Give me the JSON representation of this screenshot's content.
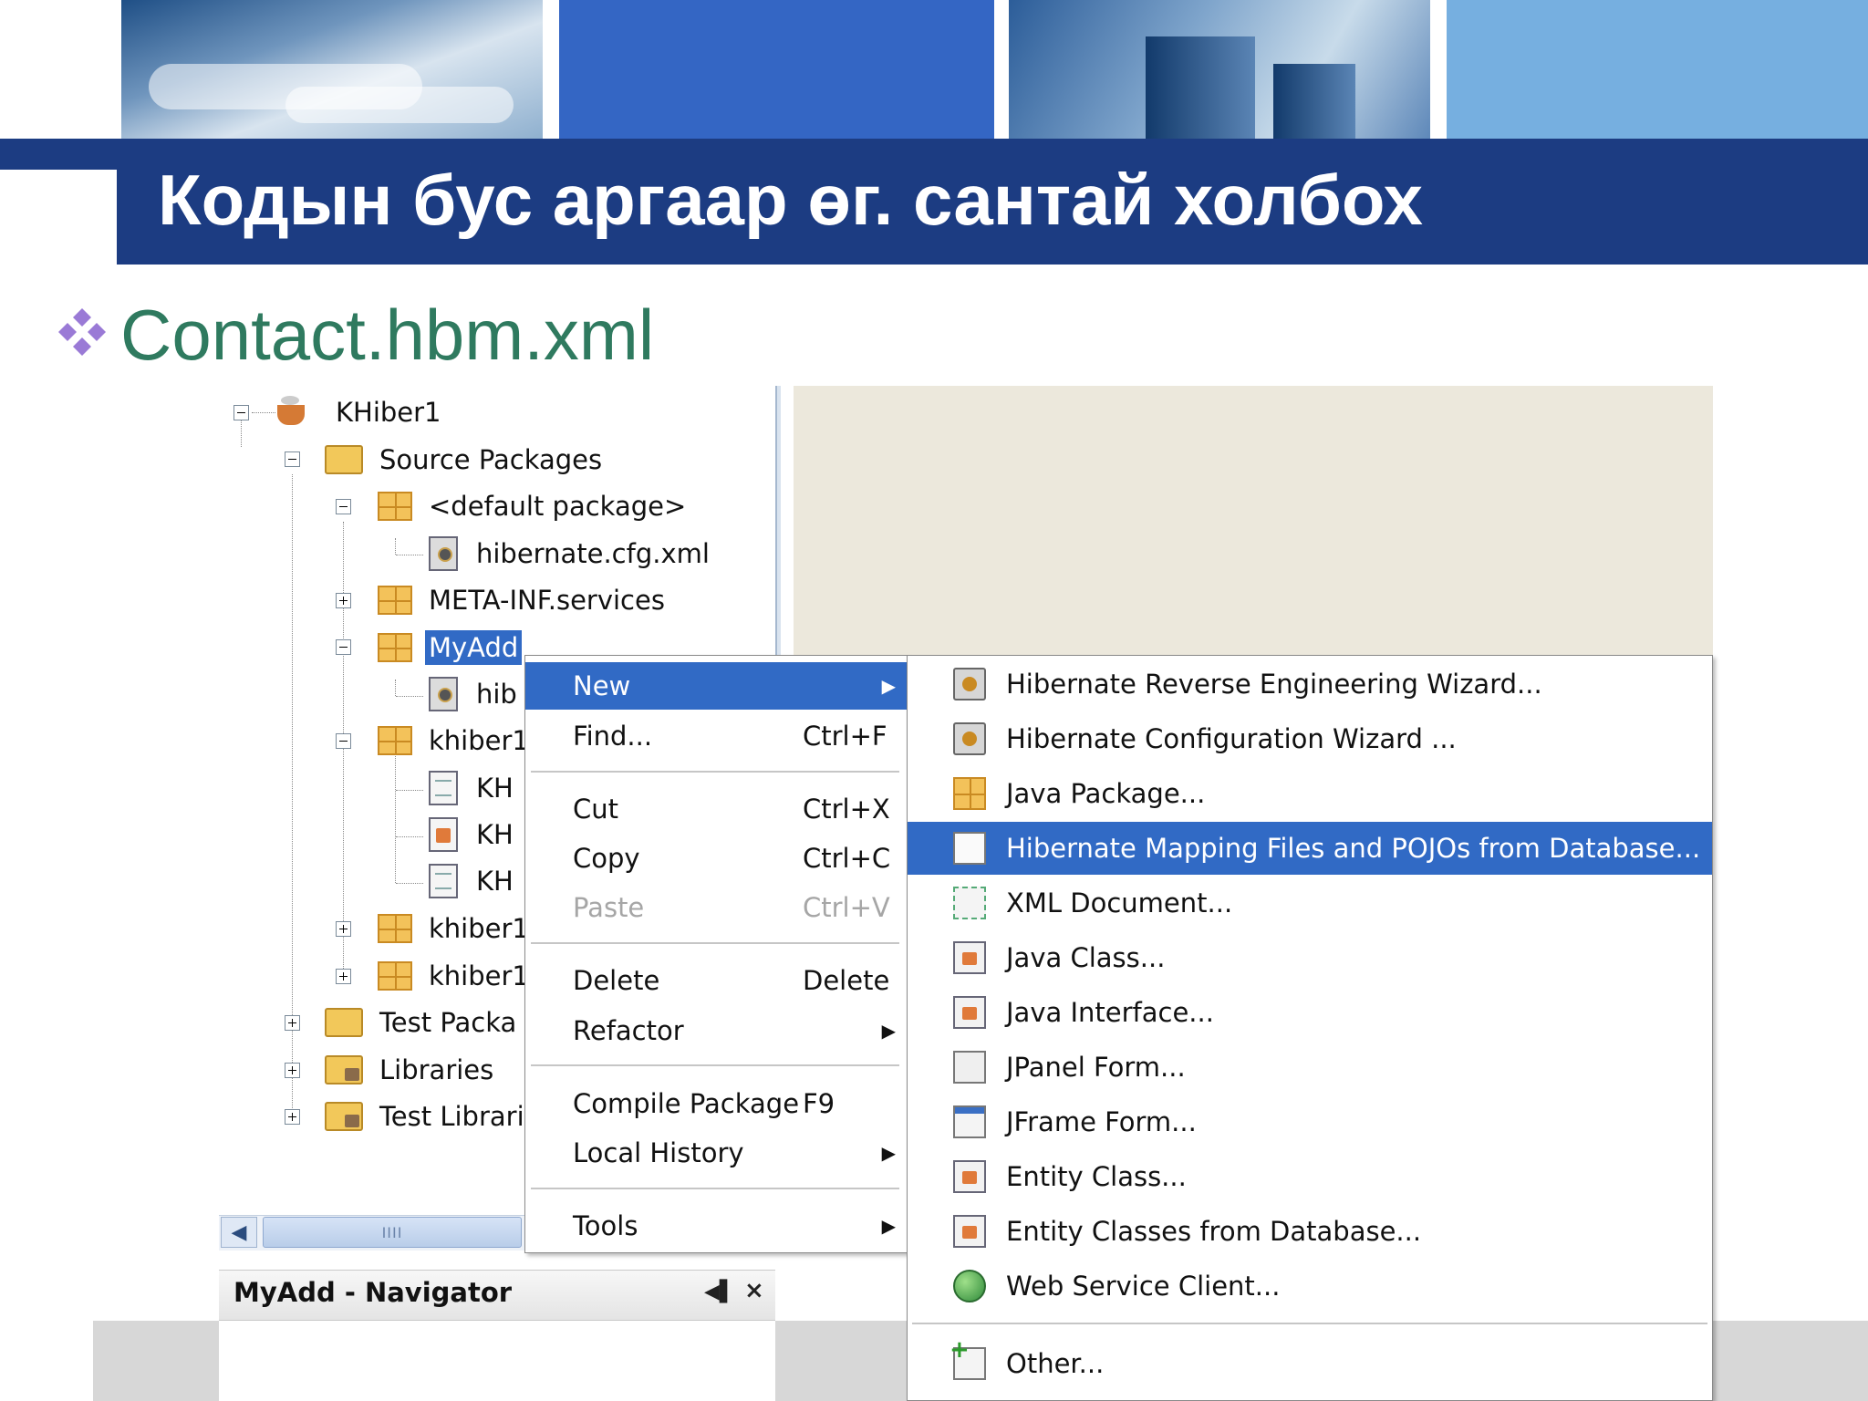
{
  "slide": {
    "title": "Кодын бус аргаар өг. сантай холбох",
    "bullet": "Contact.hbm.xml"
  },
  "tree": {
    "project": "KHiber1",
    "source_packages": "Source Packages",
    "default_package": "<default package>",
    "hibernate_cfg": "hibernate.cfg.xml",
    "meta_inf": "META-INF.services",
    "myadd": "MyAdd",
    "myadd_child": "hib",
    "khiber_pkg_1": "khiber1",
    "kh_file_1": "KH",
    "kh_file_2": "KH",
    "kh_file_3": "KH",
    "khiber_pkg_2": "khiber1",
    "khiber_pkg_3": "khiber1",
    "test_packages": "Test Packa",
    "libraries": "Libraries",
    "test_libraries": "Test Librari"
  },
  "scrollbar": {
    "grip": "IIII"
  },
  "navigator": {
    "title": "MyAdd - Navigator",
    "dock_glyph": "◀▌",
    "close_glyph": "×"
  },
  "context_menu": {
    "new": "New",
    "find": "Find...",
    "find_shortcut": "Ctrl+F",
    "cut": "Cut",
    "cut_shortcut": "Ctrl+X",
    "copy": "Copy",
    "copy_shortcut": "Ctrl+C",
    "paste": "Paste",
    "paste_shortcut": "Ctrl+V",
    "delete": "Delete",
    "delete_shortcut": "Delete",
    "refactor": "Refactor",
    "compile": "Compile Package",
    "compile_shortcut": "F9",
    "local_history": "Local History",
    "tools": "Tools"
  },
  "submenu": {
    "items": [
      {
        "label": "Hibernate Reverse Engineering Wizard...",
        "icon": "hibernate-reveng-icon"
      },
      {
        "label": "Hibernate Configuration Wizard ...",
        "icon": "hibernate-config-icon"
      },
      {
        "label": "Java Package...",
        "icon": "java-package-icon"
      },
      {
        "label": "Hibernate Mapping Files and POJOs from Database...",
        "icon": "blank-file-icon"
      },
      {
        "label": "XML Document...",
        "icon": "xml-document-icon"
      },
      {
        "label": "Java Class...",
        "icon": "java-class-icon"
      },
      {
        "label": "Java Interface...",
        "icon": "java-interface-icon"
      },
      {
        "label": "JPanel Form...",
        "icon": "jpanel-form-icon"
      },
      {
        "label": "JFrame Form...",
        "icon": "jframe-form-icon"
      },
      {
        "label": "Entity Class...",
        "icon": "entity-class-icon"
      },
      {
        "label": "Entity Classes from Database...",
        "icon": "entity-classes-db-icon"
      },
      {
        "label": "Web Service Client...",
        "icon": "web-service-globe-icon"
      },
      {
        "label": "Other...",
        "icon": "other-file-icon"
      }
    ]
  },
  "colors": {
    "title_band": "#1c3c82",
    "bullet_text": "#2f7a5f",
    "selection": "#316ac5"
  }
}
